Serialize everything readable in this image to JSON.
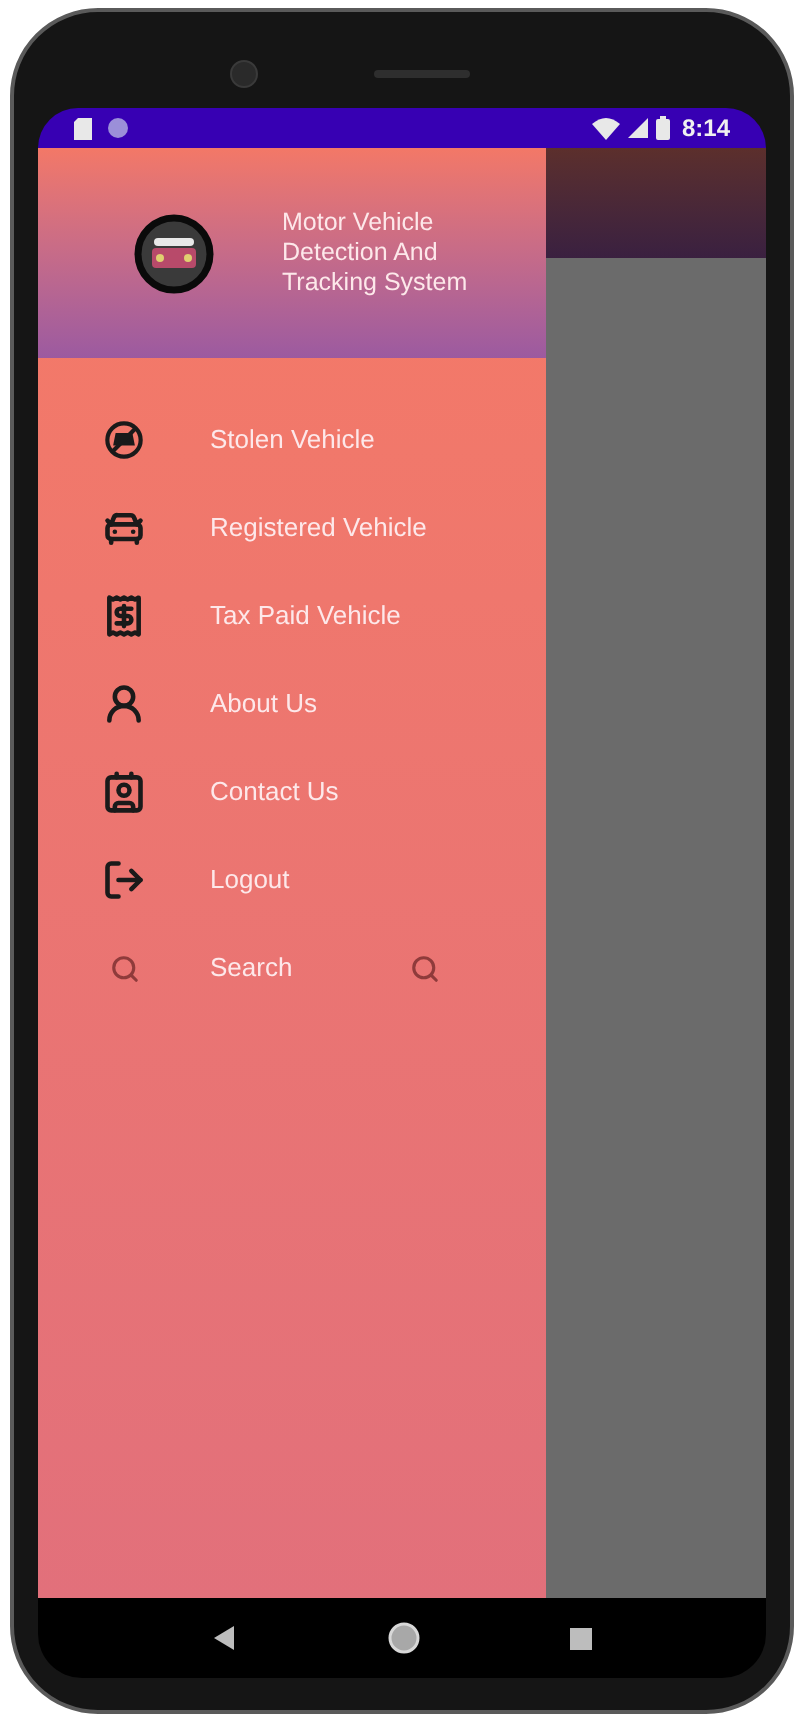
{
  "status_bar": {
    "time": "8:14"
  },
  "drawer": {
    "title": "Motor Vehicle Detection And Tracking System",
    "items": [
      {
        "kind": "nav",
        "label": "Stolen Vehicle"
      },
      {
        "kind": "nav",
        "label": "Registered Vehicle"
      },
      {
        "kind": "nav",
        "label": "Tax Paid Vehicle"
      },
      {
        "kind": "nav",
        "label": "About Us"
      },
      {
        "kind": "nav",
        "label": "Contact Us"
      },
      {
        "kind": "nav",
        "label": "Logout"
      },
      {
        "kind": "search",
        "label": "Search"
      }
    ]
  }
}
